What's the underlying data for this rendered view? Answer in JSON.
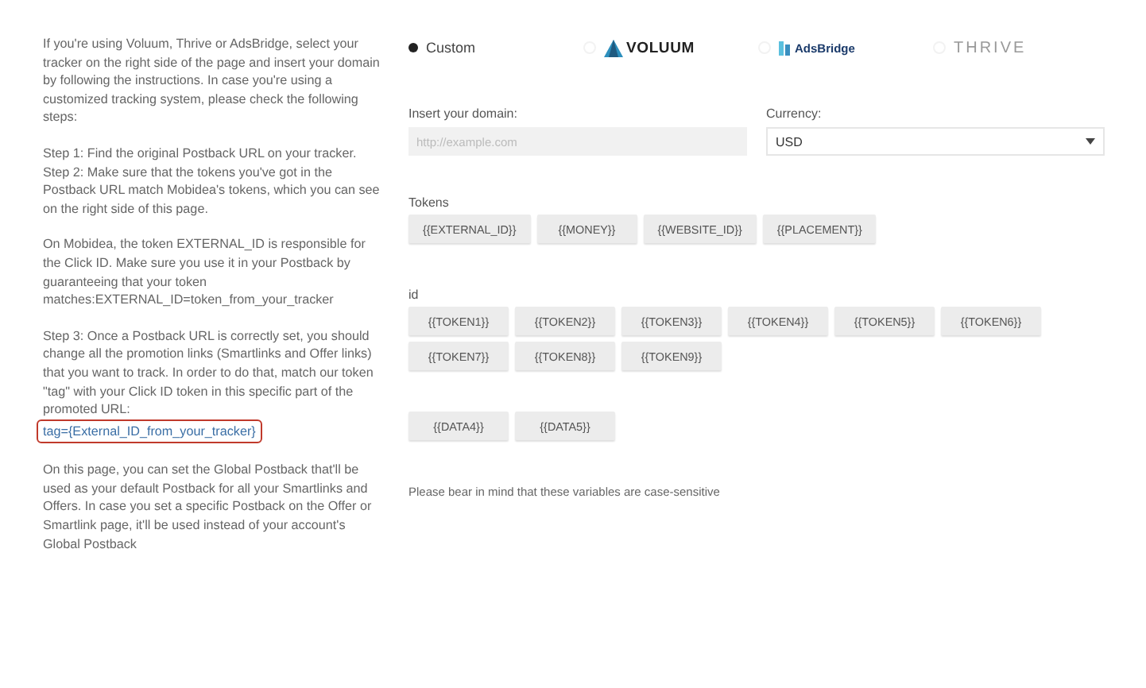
{
  "instructions": [
    {
      "kind": "text",
      "text": "If you're using Voluum, Thrive or AdsBridge, select your tracker on the right side of the page and insert your domain by following the instructions. In case you're using a customized tracking system, please check the following steps:"
    },
    {
      "kind": "text",
      "text": "Step 1: Find the original Postback URL on your tracker.\nStep 2: Make sure that the tokens you've got in the Postback URL match Mobidea's tokens, which you can see on the right side of this page."
    },
    {
      "kind": "text",
      "text": "On Mobidea, the token EXTERNAL_ID is responsible for the Click ID. Make sure you use it in your Postback by guaranteeing that your token matches:EXTERNAL_ID=token_from_your_tracker"
    },
    {
      "kind": "text",
      "text": "Step 3: Once a Postback URL is correctly set, you should change all the promotion links (Smartlinks and Offer links) that you want to track. In order to do that, match our token \"tag\" with your Click ID token in this specific part of the promoted URL:"
    },
    {
      "kind": "code",
      "text": "tag={External_ID_from_your_tracker}",
      "highlighted": true
    },
    {
      "kind": "text",
      "text": "On this page, you can set the Global Postback that'll be used as your default Postback for all your Smartlinks and Offers. In case you set a specific Postback on the Offer or Smartlink page, it'll be used instead of your account's Global Postback"
    }
  ],
  "trackers": [
    {
      "kind": "plain",
      "label": "Custom",
      "selected": true
    },
    {
      "kind": "voluum",
      "label": "VOLUUM",
      "selected": false
    },
    {
      "kind": "adsbridge",
      "label": "AdsBridge",
      "selected": false
    },
    {
      "kind": "thrive",
      "label": "THRIVE",
      "selected": false
    }
  ],
  "domain": {
    "label": "Insert your domain:",
    "placeholder": "http://example.com"
  },
  "currency": {
    "label": "Currency:",
    "value": "USD"
  },
  "token_groups": [
    {
      "label": "Tokens",
      "tokens": [
        "{{EXTERNAL_ID}}",
        "{{MONEY}}",
        "{{WEBSITE_ID}}",
        "{{PLACEMENT}}"
      ]
    },
    {
      "label": "id",
      "tokens": [
        "{{TOKEN1}}",
        "{{TOKEN2}}",
        "{{TOKEN3}}",
        "{{TOKEN4}}",
        "{{TOKEN5}}",
        "{{TOKEN6}}",
        "{{TOKEN7}}",
        "{{TOKEN8}}",
        "{{TOKEN9}}"
      ]
    },
    {
      "tokens": [
        "{{DATA4}}",
        "{{DATA5}}"
      ]
    }
  ],
  "note": "Please bear in mind that these variables are case-sensitive"
}
